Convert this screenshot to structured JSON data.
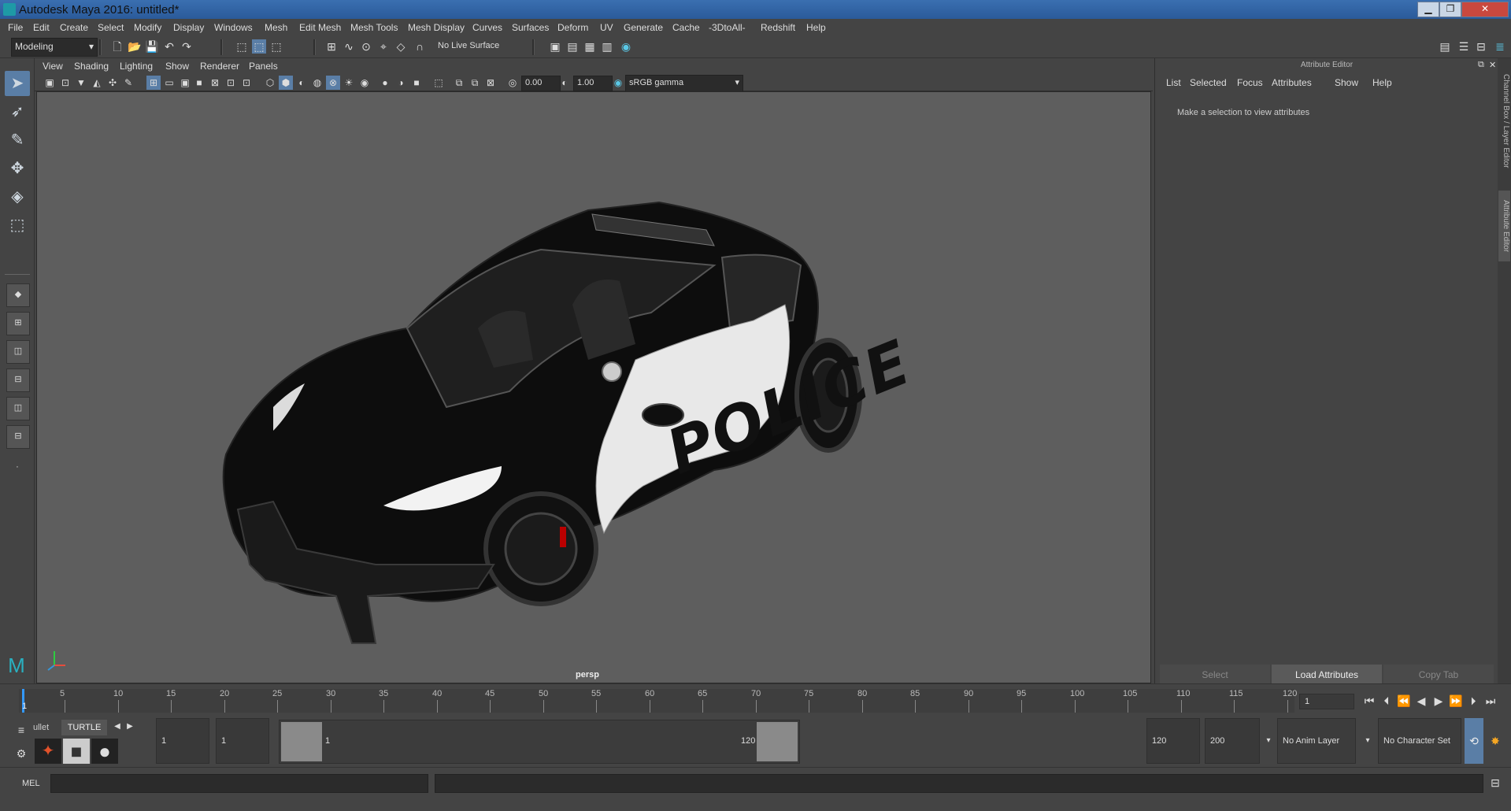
{
  "window": {
    "title": "Autodesk Maya 2016: untitled*",
    "minimize": "▁",
    "maximize": "❐",
    "close": "✕"
  },
  "menubar": [
    "File",
    "Edit",
    "Create",
    "Select",
    "Modify",
    "Display",
    "Windows",
    "Mesh",
    "Edit Mesh",
    "Mesh Tools",
    "Mesh Display",
    "Curves",
    "Surfaces",
    "Deform",
    "UV",
    "Generate",
    "Cache",
    "-3DtoAll-",
    "Redshift",
    "Help"
  ],
  "shelf": {
    "mode": "Modeling",
    "live_surface": "No Live Surface"
  },
  "viewport": {
    "menus": [
      "View",
      "Shading",
      "Lighting",
      "Show",
      "Renderer",
      "Panels"
    ],
    "exposure": "0.00",
    "gamma": "1.00",
    "color_space": "sRGB gamma",
    "camera_label": "persp",
    "door_text": "POLICE"
  },
  "attribute_editor": {
    "title": "Attribute Editor",
    "menus": [
      "List",
      "Selected",
      "Focus",
      "Attributes",
      "Show",
      "Help"
    ],
    "message": "Make a selection to view attributes",
    "buttons": {
      "select": "Select",
      "load": "Load Attributes",
      "copy": "Copy Tab"
    },
    "side_tabs": [
      "Channel Box / Layer Editor",
      "Attribute Editor"
    ]
  },
  "timeline": {
    "current_frame": "1",
    "ticks": [
      "5",
      "10",
      "15",
      "20",
      "25",
      "30",
      "35",
      "40",
      "45",
      "50",
      "55",
      "60",
      "65",
      "70",
      "75",
      "80",
      "85",
      "90",
      "95",
      "100",
      "105",
      "110",
      "115",
      "120"
    ],
    "start_tick": "1",
    "frame_field": "1"
  },
  "range": {
    "shelf_tabs": [
      "ullet",
      "TURTLE"
    ],
    "start_time": "1",
    "playback_start": "1",
    "slider_start": "1",
    "slider_end": "120",
    "playback_end": "120",
    "end_time": "200",
    "anim_layer": "No Anim Layer",
    "character_set": "No Character Set"
  },
  "command_line": {
    "label": "MEL"
  },
  "colors": {
    "accent": "#5a7ea6",
    "background": "#444444",
    "viewport": "#5e5e5e",
    "timeline_current": "#3399ff"
  }
}
